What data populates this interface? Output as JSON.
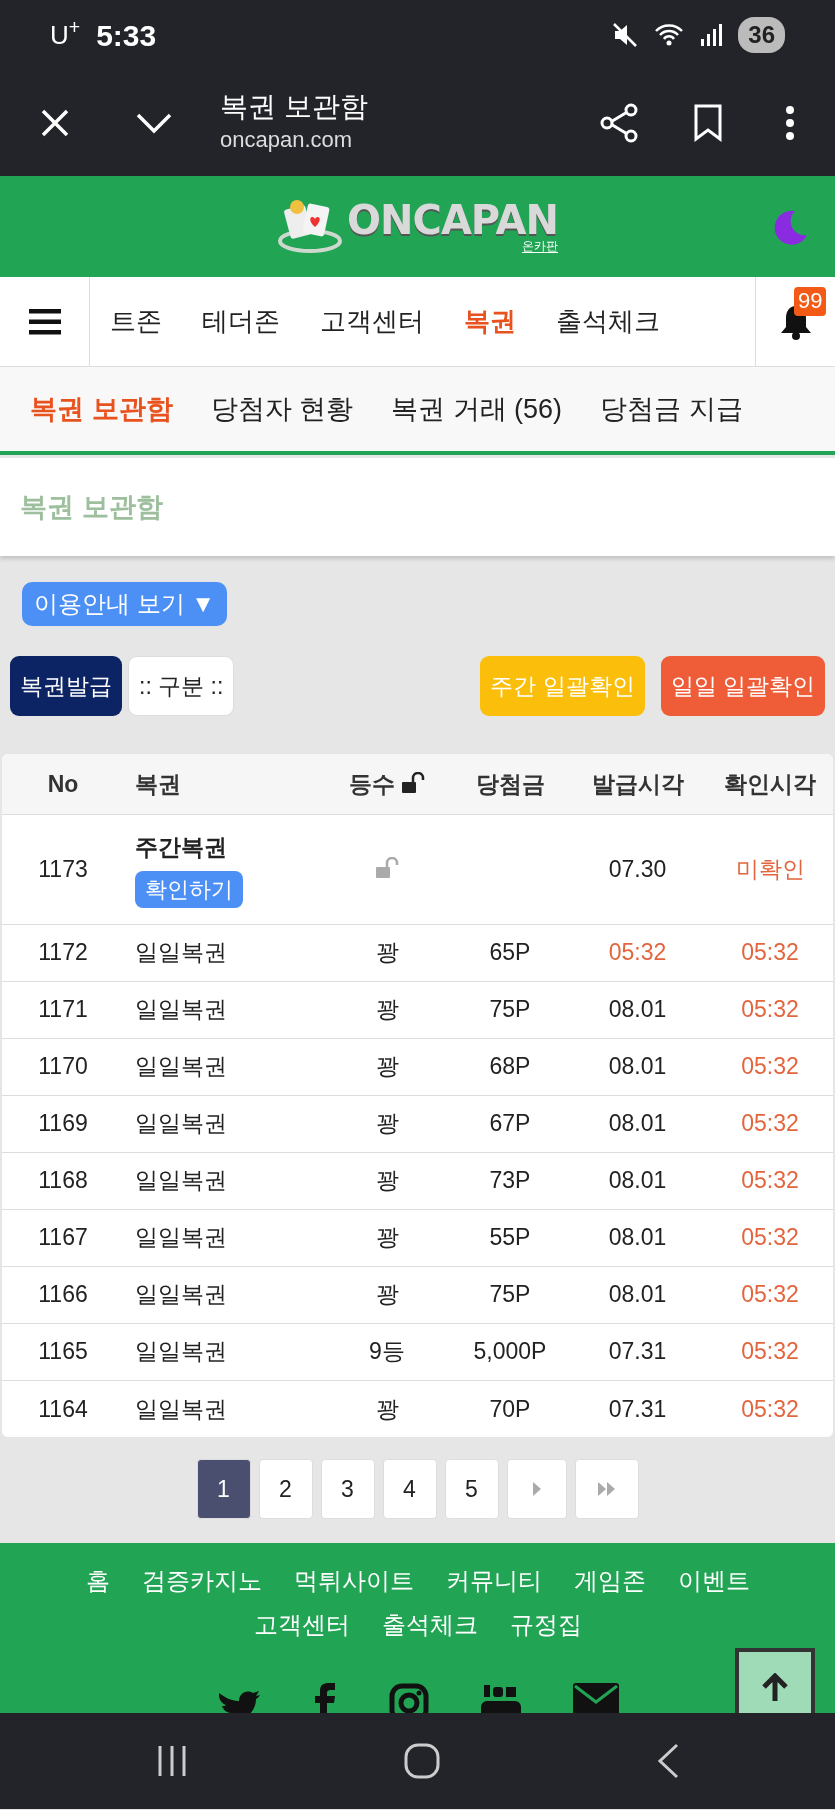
{
  "status_bar": {
    "carrier": "U$^{+}$",
    "time": "5:33",
    "battery": "36"
  },
  "browser": {
    "title": "복권 보관함",
    "url": "oncapan.com"
  },
  "site": {
    "logo_text": "ONCAPAN",
    "logo_sub": "온카판",
    "notification_count": "99",
    "nav": [
      {
        "label": "트존",
        "selected": false
      },
      {
        "label": "테더존",
        "selected": false
      },
      {
        "label": "고객센터",
        "selected": false
      },
      {
        "label": "복권",
        "selected": true
      },
      {
        "label": "출석체크",
        "selected": false
      }
    ],
    "subnav": [
      {
        "label": "복권 보관함",
        "selected": true
      },
      {
        "label": "당첨자 현황",
        "selected": false
      },
      {
        "label": "복권 거래 (56)",
        "selected": false
      },
      {
        "label": "당첨금 지급",
        "selected": false
      }
    ]
  },
  "page_title": "복권 보관함",
  "guide_button": "이용안내 보기 ▼",
  "actions": [
    {
      "kind": "issue",
      "label": "복권발급"
    },
    {
      "kind": "filter",
      "label": ":: 구분 ::"
    },
    {
      "kind": "weekly",
      "label": "주간 일괄확인"
    },
    {
      "kind": "daily",
      "label": "일일 일괄확인"
    }
  ],
  "table": {
    "columns": [
      "No",
      "복권",
      "등수",
      "당첨금",
      "발급시각",
      "확인시각"
    ],
    "rows": [
      {
        "kind": "weekly",
        "no": "1173",
        "ticket": "주간복권",
        "action": "확인하기",
        "locked": false,
        "issued": "07.30",
        "issued_highlight": false,
        "confirmed": "미확인"
      },
      {
        "kind": "daily",
        "no": "1172",
        "ticket": "일일복권",
        "rank": "꽝",
        "prize": "65P",
        "issued": "05:32",
        "issued_highlight": true,
        "confirmed": "05:32"
      },
      {
        "kind": "daily",
        "no": "1171",
        "ticket": "일일복권",
        "rank": "꽝",
        "prize": "75P",
        "issued": "08.01",
        "issued_highlight": false,
        "confirmed": "05:32"
      },
      {
        "kind": "daily",
        "no": "1170",
        "ticket": "일일복권",
        "rank": "꽝",
        "prize": "68P",
        "issued": "08.01",
        "issued_highlight": false,
        "confirmed": "05:32"
      },
      {
        "kind": "daily",
        "no": "1169",
        "ticket": "일일복권",
        "rank": "꽝",
        "prize": "67P",
        "issued": "08.01",
        "issued_highlight": false,
        "confirmed": "05:32"
      },
      {
        "kind": "daily",
        "no": "1168",
        "ticket": "일일복권",
        "rank": "꽝",
        "prize": "73P",
        "issued": "08.01",
        "issued_highlight": false,
        "confirmed": "05:32"
      },
      {
        "kind": "daily",
        "no": "1167",
        "ticket": "일일복권",
        "rank": "꽝",
        "prize": "55P",
        "issued": "08.01",
        "issued_highlight": false,
        "confirmed": "05:32"
      },
      {
        "kind": "daily",
        "no": "1166",
        "ticket": "일일복권",
        "rank": "꽝",
        "prize": "75P",
        "issued": "08.01",
        "issued_highlight": false,
        "confirmed": "05:32"
      },
      {
        "kind": "daily",
        "no": "1165",
        "ticket": "일일복권",
        "rank": "9등",
        "prize": "5,000P",
        "issued": "07.31",
        "issued_highlight": false,
        "confirmed": "05:32"
      },
      {
        "kind": "daily",
        "no": "1164",
        "ticket": "일일복권",
        "rank": "꽝",
        "prize": "70P",
        "issued": "07.31",
        "issued_highlight": false,
        "confirmed": "05:32"
      }
    ]
  },
  "pagination": [
    {
      "label": "1",
      "selected": true
    },
    {
      "label": "2",
      "selected": false
    },
    {
      "label": "3",
      "selected": false
    },
    {
      "label": "4",
      "selected": false
    },
    {
      "label": "5",
      "selected": false
    }
  ],
  "footer": {
    "links": [
      [
        "홈",
        "검증카지노",
        "먹튀사이트",
        "커뮤니티",
        "게임존",
        "이벤트"
      ],
      [
        "고객센터",
        "출석체크",
        "규정집"
      ]
    ]
  }
}
